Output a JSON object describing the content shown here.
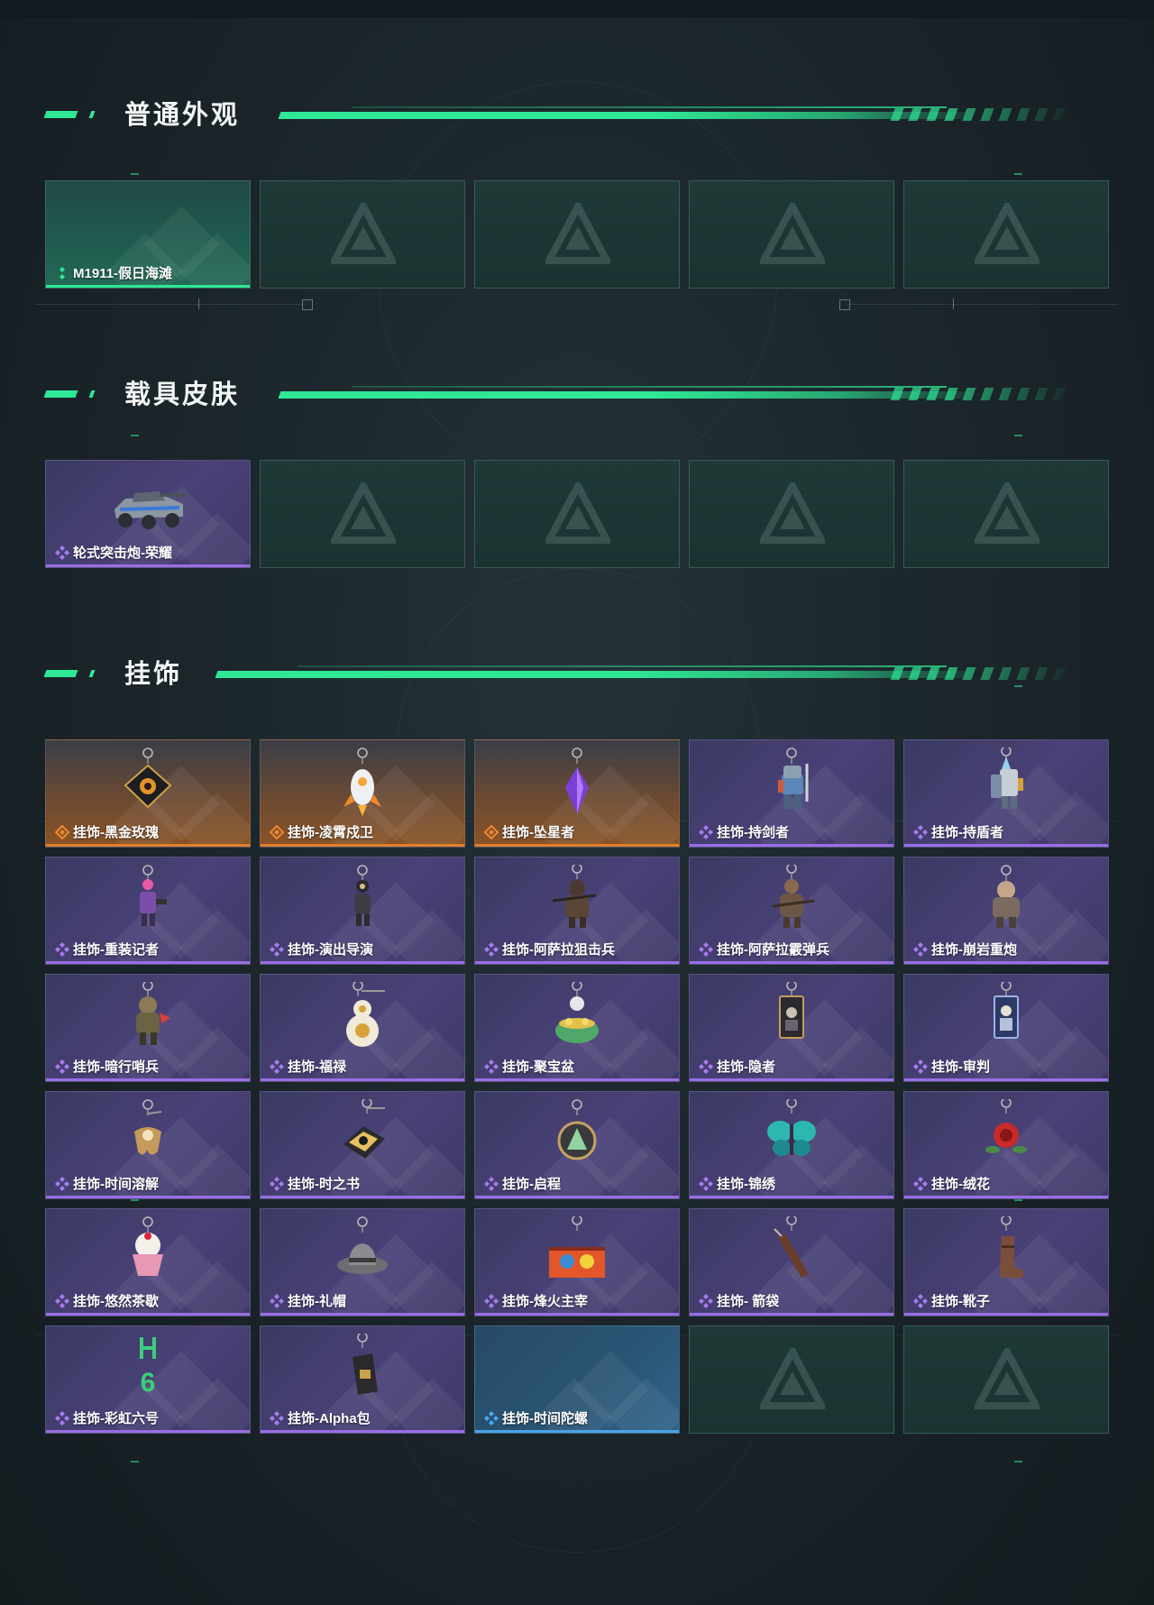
{
  "sections": [
    {
      "title": "普通外观",
      "items": [
        {
          "label": "M1911-假日海滩",
          "rarity": "green"
        },
        {
          "label": "",
          "rarity": "empty"
        },
        {
          "label": "",
          "rarity": "empty"
        },
        {
          "label": "",
          "rarity": "empty"
        },
        {
          "label": "",
          "rarity": "empty"
        }
      ]
    },
    {
      "title": "载具皮肤",
      "items": [
        {
          "label": "轮式突击炮-荣耀",
          "rarity": "purple",
          "icon": "armored-vehicle-icon"
        },
        {
          "label": "",
          "rarity": "empty"
        },
        {
          "label": "",
          "rarity": "empty"
        },
        {
          "label": "",
          "rarity": "empty"
        },
        {
          "label": "",
          "rarity": "empty"
        }
      ]
    },
    {
      "title": "挂饰",
      "items": [
        {
          "label": "挂饰-黑金玫瑰",
          "rarity": "orange",
          "icon": "black-gold-rose-charm-icon"
        },
        {
          "label": "挂饰-凌霄戍卫",
          "rarity": "orange",
          "icon": "rocket-guard-charm-icon"
        },
        {
          "label": "挂饰-坠星者",
          "rarity": "orange",
          "icon": "purple-crystal-charm-icon"
        },
        {
          "label": "挂饰-持剑者",
          "rarity": "purple",
          "icon": "sword-knight-charm-icon"
        },
        {
          "label": "挂饰-持盾者",
          "rarity": "purple",
          "icon": "shield-knight-charm-icon"
        },
        {
          "label": "挂饰-重装记者",
          "rarity": "purple",
          "icon": "reporter-charm-icon"
        },
        {
          "label": "挂饰-演出导演",
          "rarity": "purple",
          "icon": "director-charm-icon"
        },
        {
          "label": "挂饰-阿萨拉狙击兵",
          "rarity": "purple",
          "icon": "sniper-charm-icon"
        },
        {
          "label": "挂饰-阿萨拉霰弹兵",
          "rarity": "purple",
          "icon": "shotgunner-charm-icon"
        },
        {
          "label": "挂饰-崩岩重炮",
          "rarity": "purple",
          "icon": "heavy-gunner-charm-icon"
        },
        {
          "label": "挂饰-暗行哨兵",
          "rarity": "purple",
          "icon": "sentinel-charm-icon"
        },
        {
          "label": "挂饰-福禄",
          "rarity": "purple",
          "icon": "gourd-charm-icon"
        },
        {
          "label": "挂饰-聚宝盆",
          "rarity": "purple",
          "icon": "treasure-bowl-charm-icon"
        },
        {
          "label": "挂饰-隐者",
          "rarity": "purple",
          "icon": "hermit-card-charm-icon"
        },
        {
          "label": "挂饰-审判",
          "rarity": "purple",
          "icon": "judgement-card-charm-icon"
        },
        {
          "label": "挂饰-时间溶解",
          "rarity": "purple",
          "icon": "melting-clock-charm-icon"
        },
        {
          "label": "挂饰-时之书",
          "rarity": "purple",
          "icon": "book-charm-icon"
        },
        {
          "label": "挂饰-启程",
          "rarity": "purple",
          "icon": "medallion-charm-icon"
        },
        {
          "label": "挂饰-锦绣",
          "rarity": "purple",
          "icon": "butterfly-charm-icon"
        },
        {
          "label": "挂饰-绒花",
          "rarity": "purple",
          "icon": "red-flower-charm-icon"
        },
        {
          "label": "挂饰-悠然茶歇",
          "rarity": "purple",
          "icon": "cupcake-charm-icon"
        },
        {
          "label": "挂饰-礼帽",
          "rarity": "purple",
          "icon": "fedora-charm-icon"
        },
        {
          "label": "挂饰-烽火主宰",
          "rarity": "purple",
          "icon": "graffiti-crate-charm-icon"
        },
        {
          "label": "挂饰- 箭袋",
          "rarity": "purple",
          "icon": "quiver-charm-icon"
        },
        {
          "label": "挂饰-靴子",
          "rarity": "purple",
          "icon": "boot-charm-icon"
        },
        {
          "label": "挂饰-彩虹六号",
          "rarity": "purple",
          "icon": "rainbow-six-charm-icon"
        },
        {
          "label": "挂饰-Alpha包",
          "rarity": "purple",
          "icon": "alpha-pack-charm-icon"
        },
        {
          "label": "挂饰-时间陀螺",
          "rarity": "blue"
        },
        {
          "label": "",
          "rarity": "empty"
        },
        {
          "label": "",
          "rarity": "empty"
        }
      ]
    }
  ],
  "colors": {
    "accent": "#2ee896",
    "purple": "#9a6ee6",
    "orange": "#e07f2e",
    "blue": "#4aa4e8",
    "empty": "#1e3937"
  }
}
